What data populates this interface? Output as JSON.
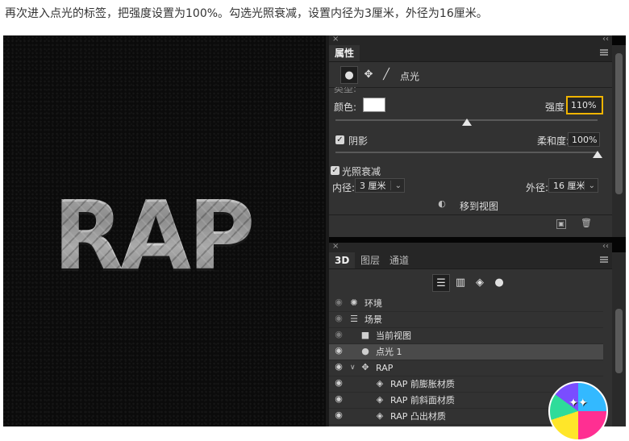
{
  "instruction": "再次进入点光的标签，把强度设置为100%。勾选光照衰减，设置内径为3厘米，外径为16厘米。",
  "canvas": {
    "text": "RAP"
  },
  "properties_panel": {
    "tab": "属性",
    "mode_label": "点光",
    "type_label": "类型:",
    "color_label": "颜色:",
    "intensity_label": "强度",
    "intensity_value": "110%",
    "intensity_level": 0.5,
    "shadow_label": "阴影",
    "softness_label": "柔和度:",
    "softness_value": "100%",
    "softness_level": 1.0,
    "falloff_label": "光照衰减",
    "inner_label": "内径:",
    "inner_value": "3 厘米",
    "outer_label": "外径:",
    "outer_value": "16 厘米",
    "move_to_view": "移到视图"
  },
  "layers_panel": {
    "tabs": [
      "3D",
      "图层",
      "通道"
    ],
    "rows": [
      {
        "label": "环境"
      },
      {
        "label": "场景"
      },
      {
        "label": "当前视图"
      },
      {
        "label": "点光 1"
      },
      {
        "label": "RAP"
      },
      {
        "label": "RAP 前膨胀材质"
      },
      {
        "label": "RAP 前斜面材质"
      },
      {
        "label": "RAP 凸出材质"
      }
    ]
  },
  "colors": {
    "highlight": "#f0b400",
    "panel_bg": "#323232"
  }
}
